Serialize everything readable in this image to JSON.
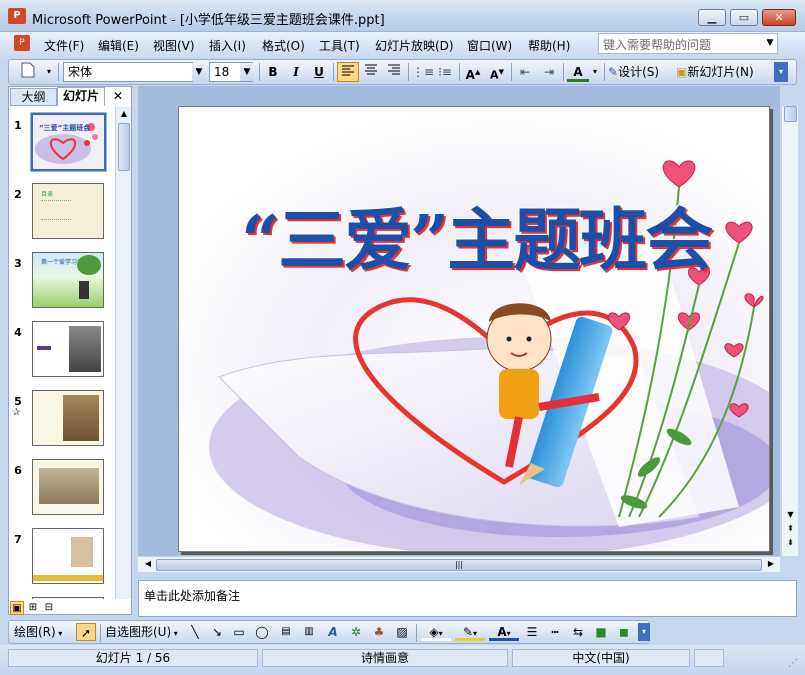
{
  "window": {
    "title": "Microsoft PowerPoint - [小学低年级三爱主题班会课件.ppt]",
    "app_icon": "powerpoint-icon"
  },
  "menu": [
    "文件(F)",
    "编辑(E)",
    "视图(V)",
    "插入(I)",
    "格式(O)",
    "工具(T)",
    "幻灯片放映(D)",
    "窗口(W)",
    "帮助(H)"
  ],
  "help_box": {
    "placeholder": "键入需要帮助的问题"
  },
  "toolbar": {
    "font": "宋体",
    "size": "18",
    "bold": "B",
    "italic": "I",
    "underline": "U",
    "design_label": "设计(S)",
    "new_slide_label": "新幻灯片(N)"
  },
  "pane": {
    "tab_outline": "大纲",
    "tab_slides": "幻灯片",
    "close": "✕"
  },
  "slides": [
    {
      "num": "1",
      "title": "“三爱”主题班会"
    },
    {
      "num": "2",
      "title": "目录"
    },
    {
      "num": "3",
      "title": "第一个爱学习活动"
    },
    {
      "num": "4",
      "title": ""
    },
    {
      "num": "5",
      "title": ""
    },
    {
      "num": "6",
      "title": ""
    },
    {
      "num": "7",
      "title": ""
    }
  ],
  "slide_main": {
    "title": "“三爱”主题班会"
  },
  "notes": {
    "placeholder": "单击此处添加备注"
  },
  "drawing_toolbar": {
    "draw_label": "绘图(R)",
    "autoshapes_label": "自选图形(U)"
  },
  "status": {
    "slide_info": "幻灯片 1 / 56",
    "design": "诗情画意",
    "language": "中文(中国)"
  },
  "colors": {
    "title_blue": "#1e4fa8",
    "heart_red": "#e8342f",
    "accent": "#3b6bb5"
  }
}
